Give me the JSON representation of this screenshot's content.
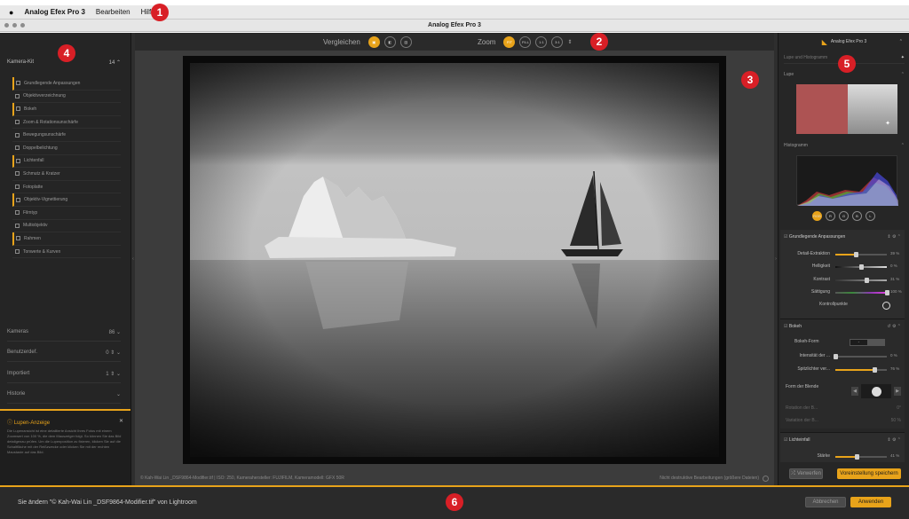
{
  "menubar": {
    "app": "Analog Efex Pro 3",
    "items": [
      "Bearbeiten",
      "Hilfe"
    ]
  },
  "window": {
    "title": "Analog Efex Pro 3"
  },
  "markers": [
    "1",
    "2",
    "3",
    "4",
    "5",
    "6"
  ],
  "left": {
    "kit_title": "Kamera-Kit",
    "kit_count": "14",
    "items": [
      {
        "label": "Grundlegende Anpassungen",
        "accent": true
      },
      {
        "label": "Objektivverzeichnung",
        "accent": false
      },
      {
        "label": "Bokeh",
        "accent": true
      },
      {
        "label": "Zoom & Rotationsunschärfe",
        "accent": false
      },
      {
        "label": "Bewegungsunschärfe",
        "accent": false
      },
      {
        "label": "Doppelbelichtung",
        "accent": false
      },
      {
        "label": "Lichtenfall",
        "accent": true
      },
      {
        "label": "Schmutz & Kratzer",
        "accent": false
      },
      {
        "label": "Fotoplatte",
        "accent": false
      },
      {
        "label": "Objektiv-Vignettierung",
        "accent": true
      },
      {
        "label": "Filmtyp",
        "accent": false
      },
      {
        "label": "Multiobjektiv",
        "accent": false
      },
      {
        "label": "Rahmen",
        "accent": true
      },
      {
        "label": "Tonwerte & Kurven",
        "accent": false
      }
    ],
    "sections": [
      {
        "label": "Kameras",
        "count": "86"
      },
      {
        "label": "Benutzerdef.",
        "count": "0"
      },
      {
        "label": "Importiert",
        "count": "1"
      },
      {
        "label": "Historie",
        "count": ""
      }
    ],
    "info": {
      "title": "Lupen-Anzeige",
      "text": "Die Lupenansicht ist eine detaillierte Ansicht Ihres Fotos mit einem Zoomwert von 100 %, die dem Mauszeiger folgt. So können Sie das Bild detailgenau prüfen. Um die Lupenposition zu fixieren, klicken Sie auf die Schaltfläche mit der Reißzwecke oder klicken Sie mit der rechten Maustaste auf das Bild."
    }
  },
  "toolbar": {
    "compare_label": "Vergleichen",
    "zoom_label": "Zoom",
    "zoom_buttons": [
      "FIT",
      "FILL",
      "1:1",
      "3:1"
    ]
  },
  "status": {
    "file_info": "© Kah-Wai Lin _DSF9864-Modifier.tif  |  ISO: 250, Kamerahersteller: FUJIFILM, Kameramodell: GFX 50R",
    "nondestructive": "Nicht destruktive Bearbeitungen (größere Dateien)"
  },
  "right": {
    "logo": "Analog Efex Pro 3",
    "loupe_hist": "Lupe und Histogramm",
    "loupe": "Lupe",
    "histogram": "Histogramm",
    "hist_buttons": [
      "RGB",
      "R",
      "G",
      "B",
      "L"
    ],
    "basic": {
      "title": "Grundlegende Anpassungen",
      "sliders": [
        {
          "label": "Detail-Extraktion",
          "value": "39 %",
          "pos": 0.39
        },
        {
          "label": "Helligkeit",
          "value": "0 %",
          "pos": 0.5
        },
        {
          "label": "Kontrast",
          "value": "31 %",
          "pos": 0.6
        },
        {
          "label": "Sättigung",
          "value": "100 %",
          "pos": 1.0
        }
      ],
      "controlpoints": "Kontrollpunkte"
    },
    "bokeh": {
      "title": "Bokeh",
      "shape_label": "Bokeh-Form",
      "sliders": [
        {
          "label": "Intensität der ...",
          "value": "0 %",
          "pos": 0.0
        },
        {
          "label": "Spitzlichter ver...",
          "value": "76 %",
          "pos": 0.76
        }
      ],
      "aperture_label": "Form der Blende",
      "dim_sliders": [
        {
          "label": "Rotation der B...",
          "value": "0°"
        },
        {
          "label": "Variation der B...",
          "value": "50 %"
        }
      ]
    },
    "light": {
      "title": "Lichteinfall",
      "slider": {
        "label": "Stärke",
        "value": "41 %",
        "pos": 0.41
      }
    },
    "btn_discard": "Verwerfen",
    "btn_save": "Voreinstellung speichern"
  },
  "bottom": {
    "message": "Sie ändern \"© Kah-Wai Lin _DSF9864-Modifier.tif\" von Lightroom",
    "cancel": "Abbrechen",
    "apply": "Anwenden"
  },
  "colors": {
    "accent": "#e8a31a",
    "marker": "#d81f26"
  }
}
